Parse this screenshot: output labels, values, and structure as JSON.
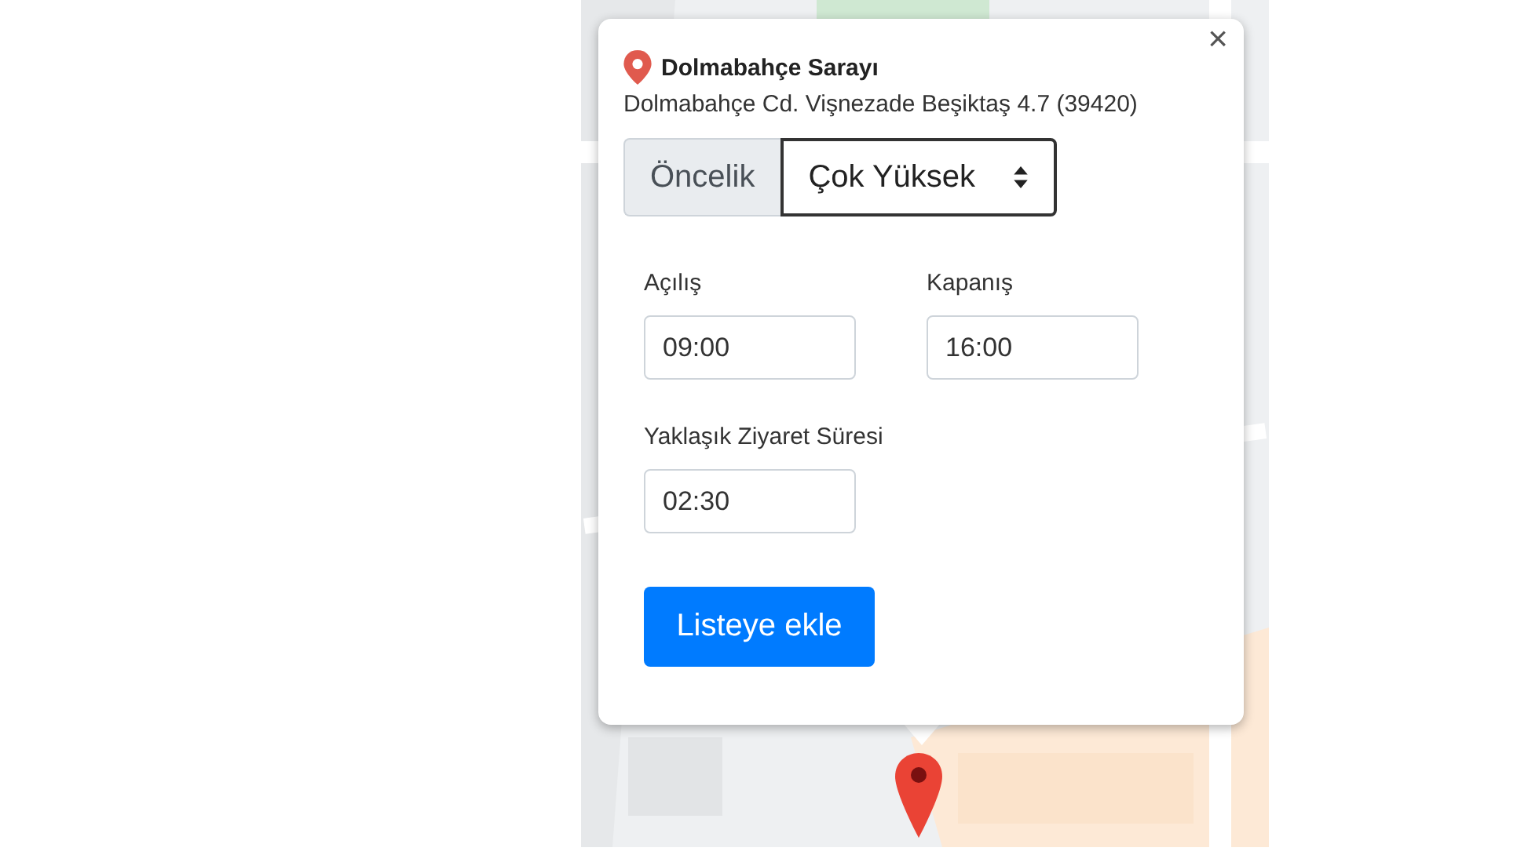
{
  "place": {
    "name": "Dolmabahçe Sarayı",
    "address": "Dolmabahçe Cd. Vişnezade Beşiktaş 4.7 (39420)"
  },
  "close": "×",
  "priority": {
    "label": "Öncelik",
    "value": "Çok Yüksek"
  },
  "fields": [
    {
      "label": "Açılış",
      "value": "09:00"
    },
    {
      "label": "Kapanış",
      "value": "16:00"
    },
    {
      "label": "Yaklaşık Ziyaret Süresi",
      "value": "02:30"
    }
  ],
  "button": "Listeye ekle"
}
